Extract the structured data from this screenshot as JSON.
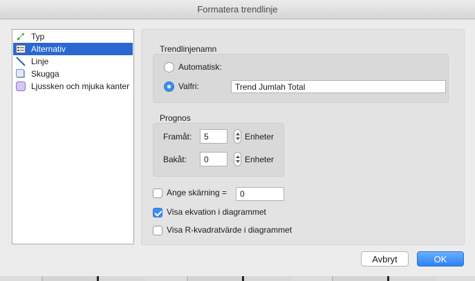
{
  "window": {
    "title": "Formatera trendlinje"
  },
  "sidebar": {
    "items": [
      {
        "label": "Typ",
        "icon": "trend-type-icon",
        "selected": false
      },
      {
        "label": "Alternativ",
        "icon": "options-icon",
        "selected": true
      },
      {
        "label": "Linje",
        "icon": "line-icon",
        "selected": false
      },
      {
        "label": "Skugga",
        "icon": "shadow-icon",
        "selected": false
      },
      {
        "label": "Ljussken och mjuka kanter",
        "icon": "glow-icon",
        "selected": false
      }
    ]
  },
  "trendline_name": {
    "heading": "Trendlinjenamn",
    "automatic_label": "Automatisk:",
    "automatic_selected": false,
    "custom_label": "Valfri:",
    "custom_selected": true,
    "custom_value": "Trend Jumlah Total"
  },
  "forecast": {
    "heading": "Prognos",
    "forward_label": "Framåt:",
    "forward_value": "5",
    "forward_unit": "Enheter",
    "backward_label": "Bakåt:",
    "backward_value": "0",
    "backward_unit": "Enheter"
  },
  "options": {
    "intercept_label": "Ange skärning =",
    "intercept_checked": false,
    "intercept_value": "0",
    "show_equation_label": "Visa ekvation i diagrammet",
    "show_equation_checked": true,
    "show_r2_label": "Visa R-kvadratvärde i diagrammet",
    "show_r2_checked": false
  },
  "footer": {
    "cancel_label": "Avbryt",
    "ok_label": "OK"
  },
  "colors": {
    "accent": "#3b8ef0",
    "selection": "#2b67d1",
    "ok_button": "#2c82f5"
  }
}
